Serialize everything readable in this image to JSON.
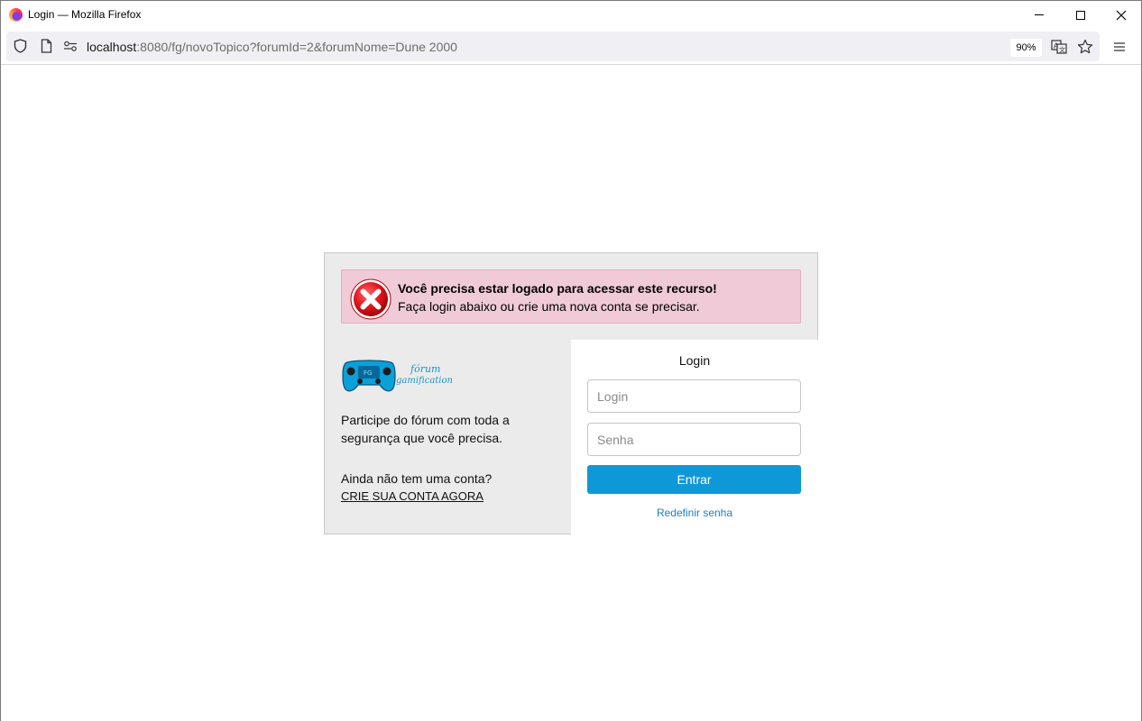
{
  "window": {
    "title": "Login — Mozilla Firefox"
  },
  "toolbar": {
    "url_host": "localhost",
    "url_rest": ":8080/fg/novoTopico?forumId=2&forumNome=Dune 2000",
    "zoom": "90%"
  },
  "alert": {
    "title": "Você precisa estar logado para acessar este recurso!",
    "message": "Faça login abaixo ou crie uma nova conta se precisar."
  },
  "left": {
    "logo_text_line1": "fórum",
    "logo_text_line2": "gamification",
    "tagline": "Participe do fórum com toda a segurança que você precisa.",
    "no_account": "Ainda não tem uma conta?",
    "create_account": "CRIE SUA CONTA AGORA"
  },
  "form": {
    "title": "Login",
    "login_placeholder": "Login",
    "password_placeholder": "Senha",
    "submit_label": "Entrar",
    "reset_label": "Redefinir senha"
  },
  "colors": {
    "accent": "#0f98d8",
    "alert_bg": "#f0cbd7",
    "panel_bg": "#ebebeb"
  }
}
